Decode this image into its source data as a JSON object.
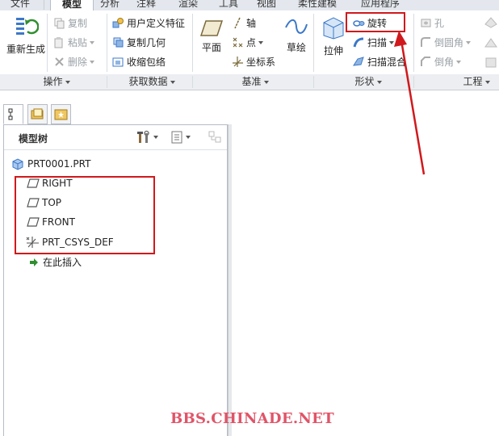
{
  "tabs": [
    "文件",
    "模型",
    "分析",
    "注释",
    "渲染",
    "工具",
    "视图",
    "柔性建模",
    "应用程序"
  ],
  "active_tab": "模型",
  "ribbon": {
    "operations": {
      "regenerate": "重新生成",
      "copy": "复制",
      "paste": "粘贴",
      "delete": "删除"
    },
    "get_data": {
      "udf": "用户定义特征",
      "copy_geometry": "复制几何",
      "shrinkwrap": "收缩包络"
    },
    "datum": {
      "plane": "平面",
      "axis": "轴",
      "point": "点",
      "csys": "坐标系",
      "sketch": "草绘"
    },
    "shapes": {
      "extrude": "拉伸",
      "revolve": "旋转",
      "sweep": "扫描",
      "swept_blend": "扫描混合"
    },
    "engineering": {
      "hole": "孔",
      "round": "倒圆角",
      "chamfer": "倒角"
    },
    "groups": [
      "操作",
      "获取数据",
      "基准",
      "形状",
      "工程"
    ]
  },
  "model_tree": {
    "title": "模型树",
    "root": "PRT0001.PRT",
    "items": [
      "RIGHT",
      "TOP",
      "FRONT",
      "PRT_CSYS_DEF"
    ],
    "insert_here": "在此插入"
  },
  "watermark": "BBS.CHINADE.NET",
  "colors": {
    "highlight_red": "#d0191c",
    "watermark": "#e05468",
    "icon_blue": "#3c78c8",
    "icon_green": "#2f8f2f"
  }
}
